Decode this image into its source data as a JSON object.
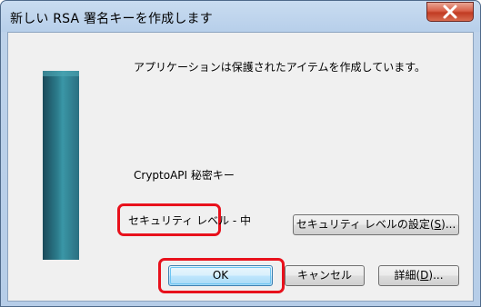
{
  "window": {
    "title": "新しい RSA 署名キーを作成します",
    "close_label": "X"
  },
  "content": {
    "message": "アプリケーションは保護されたアイテムを作成しています。",
    "key_name": "CryptoAPI 秘密キー",
    "security_level": "セキュリティ レベル - 中"
  },
  "buttons": {
    "settings": {
      "label": "セキュリティ レベルの設定(",
      "mnemonic": "S",
      "suffix": ")..."
    },
    "ok": "OK",
    "cancel": "キャンセル",
    "detail": {
      "label": "詳細(",
      "mnemonic": "D",
      "suffix": ")..."
    }
  },
  "highlight_color": "#e8111c"
}
